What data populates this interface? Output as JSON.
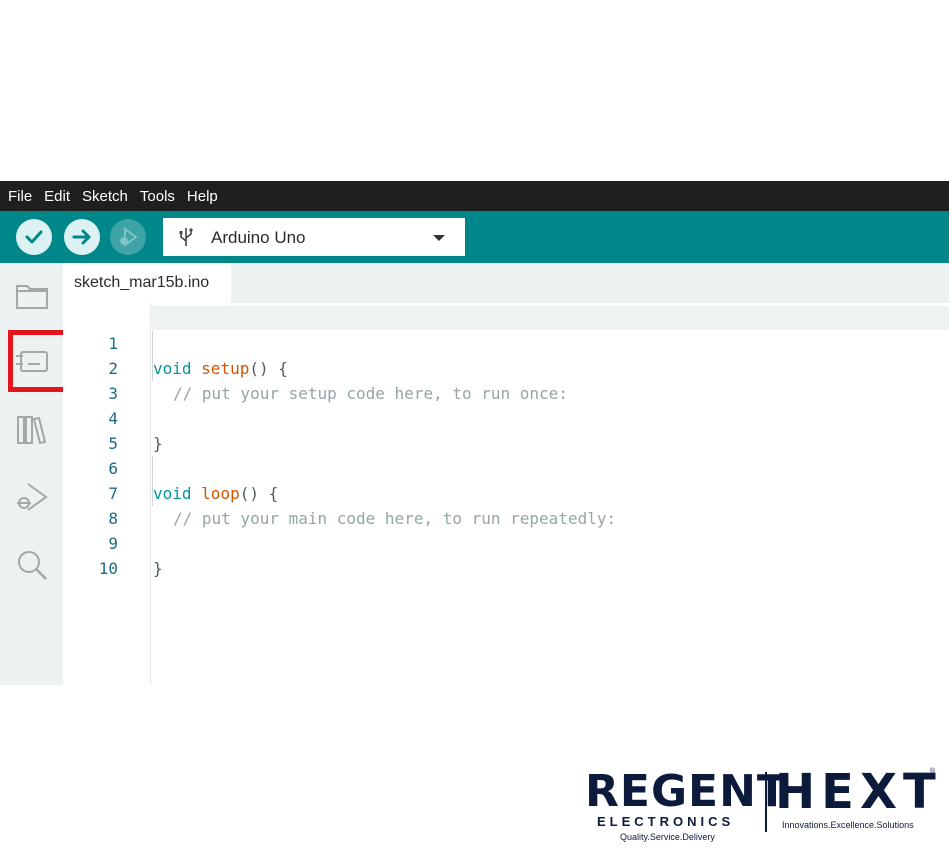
{
  "menu": [
    "File",
    "Edit",
    "Sketch",
    "Tools",
    "Help"
  ],
  "toolbar": {
    "verify_icon": "check-icon",
    "upload_icon": "arrow-right-icon",
    "debug_icon": "debugger-icon",
    "board": "Arduino Uno",
    "accent_color": "#00878a"
  },
  "sidebar": {
    "icons": [
      "folder-icon",
      "board-manager-icon",
      "library-manager-icon",
      "debug-icon",
      "search-icon"
    ],
    "highlighted": "board-manager-icon",
    "highlight_color": "#e3141c"
  },
  "editor": {
    "tab": "sketch_mar15b.ino",
    "lines": {
      "n1": "1",
      "n2": "2",
      "n3": "3",
      "n4": "4",
      "n5": "5",
      "n6": "6",
      "n7": "7",
      "n8": "8",
      "n9": "9",
      "n10": "10",
      "l1_kw": "void",
      "l1_fn": "setup",
      "l1_rest": "() {",
      "l2_cm": "// put your setup code here, to run once:",
      "l4": "}",
      "l6_kw": "void",
      "l6_fn": "loop",
      "l6_rest": "() {",
      "l7_cm": "// put your main code here, to run repeatedly:",
      "l9": "}"
    }
  },
  "logo": {
    "regent": "REGENT",
    "electronics": "ELECTRONICS",
    "regent_tagline": "Quality.Service.Delivery",
    "hext": "HEXT",
    "hext_tagline": "Innovations.Excellence.Solutions",
    "registered": "®"
  }
}
